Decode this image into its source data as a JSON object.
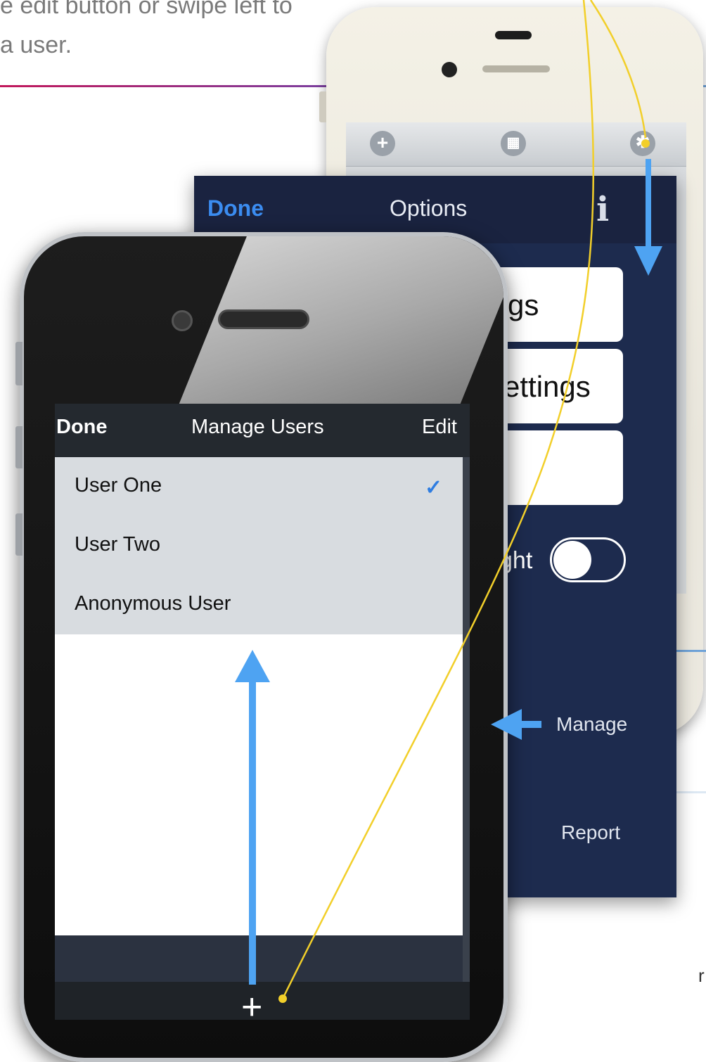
{
  "instruction": {
    "line1": "e edit button or swipe left to",
    "line2": "a user."
  },
  "options_panel": {
    "done_label": "Done",
    "title": "Options",
    "info_glyph": "i",
    "row1_partial": "gs",
    "row2_partial": "ettings",
    "toggle_partial_label": "ght",
    "toggle_on": false,
    "manage_label": "Manage",
    "report_label": "Report"
  },
  "toolbar_icons": [
    "plus-circle-icon",
    "grid-icon",
    "gear-icon"
  ],
  "manage_users": {
    "done_label": "Done",
    "title": "Manage Users",
    "edit_label": "Edit",
    "users": [
      {
        "name": "User One",
        "selected": true
      },
      {
        "name": "User Two",
        "selected": false
      },
      {
        "name": "Anonymous User",
        "selected": false
      }
    ],
    "add_glyph": "+",
    "check_glyph": "✓"
  },
  "colors": {
    "accent_blue": "#3b8cf0",
    "arrow_blue": "#4ea3f2",
    "callout_yellow": "#f2cf2a",
    "panel_navy": "#1d2b4e"
  },
  "corner_glyph": "r"
}
